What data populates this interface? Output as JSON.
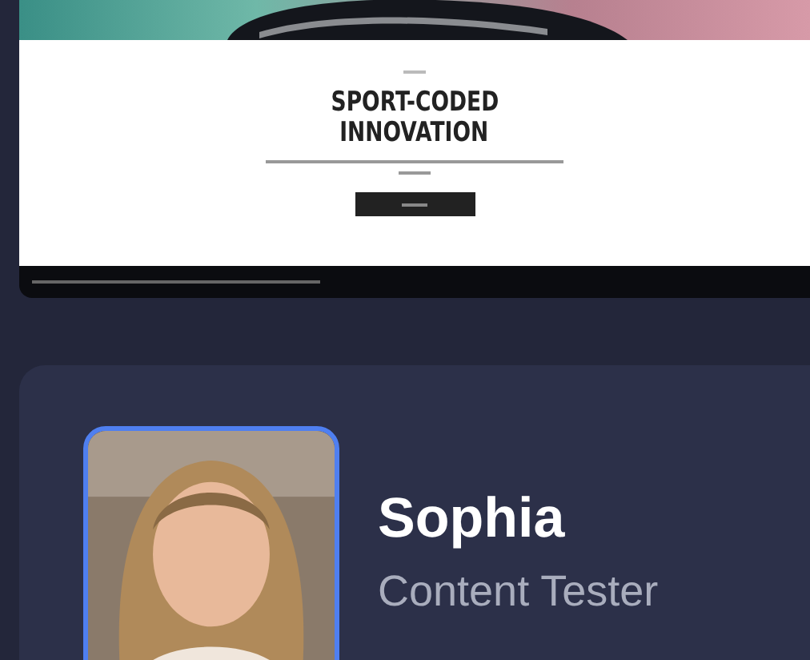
{
  "preview": {
    "headline": [
      "SPORT-CODED",
      "INNOVATION"
    ]
  },
  "profile": {
    "name": "Sophia",
    "role": "Content Tester"
  }
}
